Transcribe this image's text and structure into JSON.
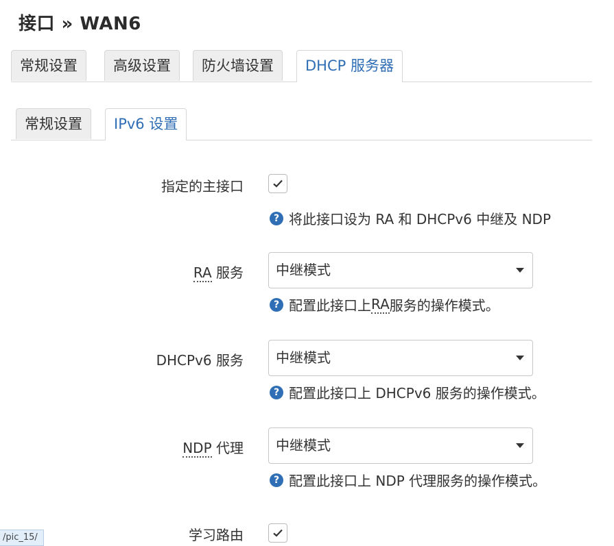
{
  "page": {
    "title": "接口 » WAN6"
  },
  "main_tabs": [
    {
      "label": "常规设置",
      "active": false
    },
    {
      "label": "高级设置",
      "active": false
    },
    {
      "label": "防火墙设置",
      "active": false
    },
    {
      "label": "DHCP 服务器",
      "active": true
    }
  ],
  "sub_tabs": [
    {
      "label": "常规设置",
      "active": false
    },
    {
      "label": "IPv6 设置",
      "active": true
    }
  ],
  "fields": {
    "master": {
      "label": "指定的主接口",
      "checked": true,
      "hint": "将此接口设为 RA 和 DHCPv6 中继及 NDP"
    },
    "ra": {
      "label_abbr": "RA",
      "label_rest": " 服务",
      "value": "中继模式",
      "hint_pre": "配置此接口上 ",
      "hint_abbr": "RA",
      "hint_post": " 服务的操作模式。"
    },
    "dhcpv6": {
      "label": "DHCPv6 服务",
      "value": "中继模式",
      "hint": "配置此接口上 DHCPv6 服务的操作模式。"
    },
    "ndp": {
      "label_abbr": "NDP",
      "label_rest": " 代理",
      "value": "中继模式",
      "hint": "配置此接口上 NDP 代理服务的操作模式。"
    },
    "learn_routes": {
      "label": "学习路由",
      "checked": true
    }
  },
  "status_bar": {
    "url": "/pic_15/"
  },
  "colors": {
    "accent": "#2f6eb5",
    "tab_inactive_bg": "#eeeeee",
    "border": "#d6d6d6"
  },
  "icons": {
    "help": "question-circle-icon",
    "check": "checkmark-icon",
    "dropdown": "caret-down-icon"
  }
}
